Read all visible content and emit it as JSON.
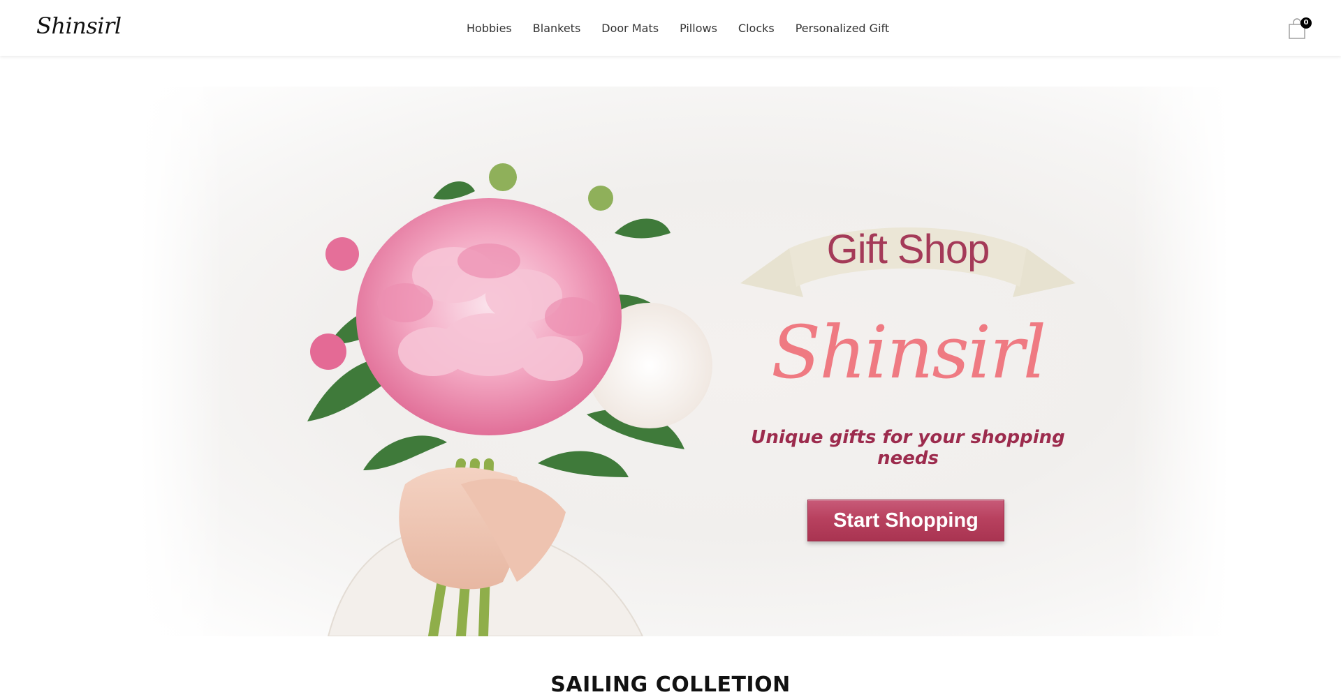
{
  "header": {
    "logo": "Shinsirl",
    "nav": [
      {
        "label": "Hobbies"
      },
      {
        "label": "Blankets"
      },
      {
        "label": "Door Mats"
      },
      {
        "label": "Pillows"
      },
      {
        "label": "Clocks"
      },
      {
        "label": "Personalized Gift"
      }
    ],
    "cart": {
      "icon": "shopping-bag-icon",
      "count": "0"
    }
  },
  "hero": {
    "title": "Gift Shop",
    "brand": "Shinsirl",
    "tagline": "Unique gifts for your shopping needs",
    "cta_label": "Start Shopping",
    "colors": {
      "title": "#a43a58",
      "brand": "#ef7a82",
      "tagline": "#9c2b4d",
      "button": "#b8415f",
      "ribbon": "#e9e4d4"
    }
  },
  "sections": {
    "first_title": "SAILING COLLETION"
  }
}
